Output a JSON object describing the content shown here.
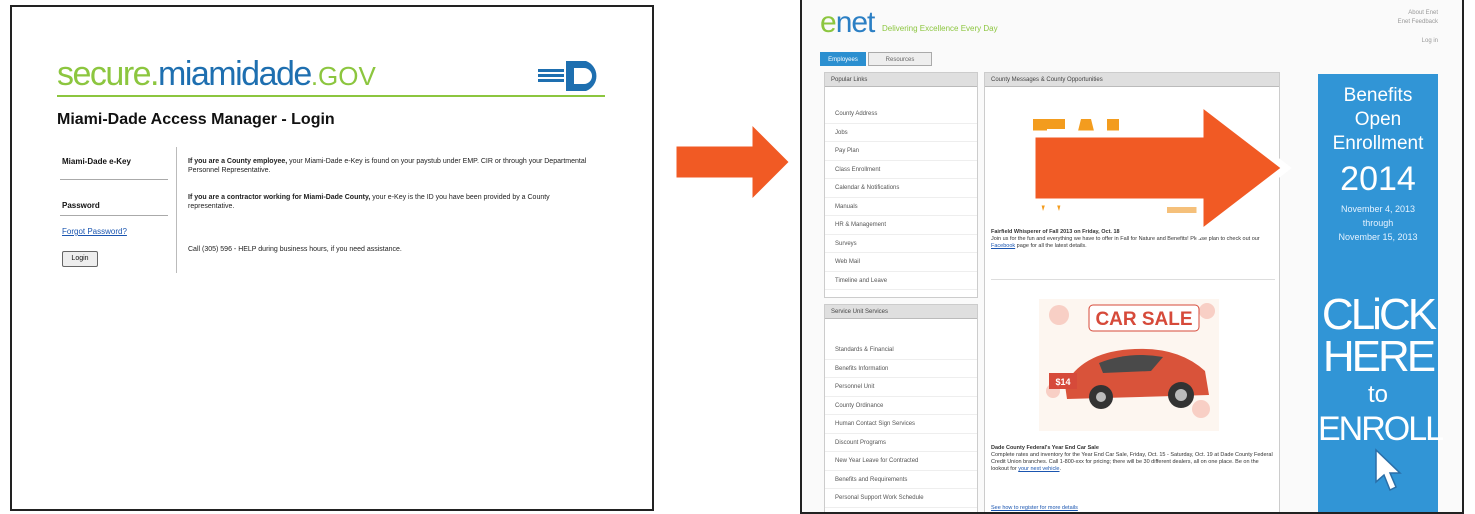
{
  "login": {
    "brand_part1": "secure.",
    "brand_part2": "miamidade",
    "brand_part3": ".GOV",
    "title": "Miami-Dade Access Manager - Login",
    "ekey_label": "Miami-Dade e-Key",
    "password_label": "Password",
    "forgot_link": "Forgot Password?",
    "login_button": "Login",
    "employee_bold": "If you are a County employee,",
    "employee_text": " your Miami-Dade e-Key is found on your paystub under EMP. CIR or through your Departmental Personnel Representative.",
    "contractor_bold": "If you are a contractor working for Miami-Dade County,",
    "contractor_text": " your e-Key is the ID you have been provided by a County representative.",
    "help_text": "Call (305) 596 - HELP during business hours, if you need assistance."
  },
  "enet": {
    "logo_e": "e",
    "logo_rest": "net",
    "tagline": "Delivering Excellence Every Day",
    "top_right_1": "About Enet",
    "top_right_2": "Enet Feedback",
    "top_right_3": "Log in",
    "tab_active": "Employees",
    "tab_inactive": "Resources",
    "popular_links_header": "Popular Links",
    "popular_links": [
      "County Address",
      "Jobs",
      "Pay Plan",
      "Class Enrollment",
      "Calendar & Notifications",
      "Manuals",
      "HR & Management",
      "Surveys",
      "Web Mail",
      "Timeline and Leave"
    ],
    "service_header": "Service Unit Services",
    "service_items": [
      "Standards & Financial",
      "Benefits Information",
      "Personnel Unit",
      "County Ordinance",
      "Human Contact Sign Services",
      "Discount Programs",
      "New Year Leave for Contracted",
      "Benefits and Requirements",
      "Personal Support Work Schedule"
    ],
    "news_header": "County Messages & County Opportunities",
    "news1_title": "Fairfield Whisperer of Fall 2013 on Friday, Oct. 18",
    "news1_body": "Join us for the fun and everything we have to offer in Fall for Nature and Benefits! Please plan to check out our",
    "news1_link": "Facebook",
    "news1_tail": " page for all the latest details.",
    "carsale_label": "CAR SALE",
    "price_label": "$14",
    "news2_title": "Dade County Federal's Year End Car Sale",
    "news2_body": "Complete rates and inventory for the Year End Car Sale, Friday, Oct. 15 - Saturday, Oct. 19 at Dade County Federal Credit Union branches. Call 1-800-xxx for pricing; there will be 30 different dealers, all on one place. Be on the lookout for",
    "news2_link": "your next vehicle",
    "news3_link": "See how to register for more details",
    "banner_line1": "Benefits",
    "banner_line2": "Open",
    "banner_line3": "Enrollment",
    "banner_year": "2014",
    "banner_date1": "November 4, 2013",
    "banner_through": "through",
    "banner_date2": "November 15, 2013",
    "banner_click": "CLiCK",
    "banner_here": "HERE",
    "banner_to": "to",
    "banner_enroll": "ENROLL"
  },
  "colors": {
    "brand_green": "#8cc63f",
    "brand_blue": "#1e6fb0",
    "arrow_orange": "#f15a24",
    "banner_blue": "#3195d6"
  }
}
